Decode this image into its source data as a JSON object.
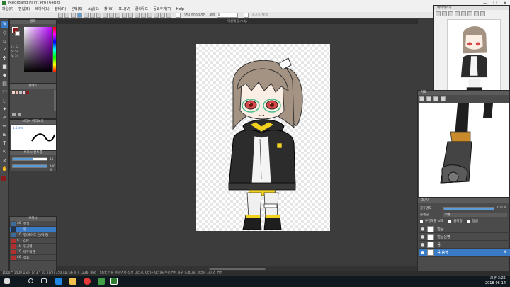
{
  "app": {
    "title": "MediBang Paint Pro (64bit)"
  },
  "window_controls": {
    "minimize": "—",
    "maximize": "☐",
    "close": "✕"
  },
  "menu": [
    "파일(F)",
    "편집(E)",
    "레이어(L)",
    "필터(R)",
    "선택(S)",
    "스냅(S)",
    "창(W)",
    "표시(V)",
    "클라우드",
    "동료추가(T)",
    "Help"
  ],
  "toolbar": {
    "aa_label": "안티 에일리어싱",
    "correction_label": "보정",
    "correction_value": "0",
    "fill_label": "소프트 채색"
  },
  "document": {
    "tab_title": "이름없음.mdp"
  },
  "color_panel": {
    "title": "컬러",
    "h": "H: 54",
    "s": "S: 54",
    "v": "V: 54"
  },
  "palette_panel": {
    "title": "팔레트"
  },
  "brush_preview_panel": {
    "title": "브러시 미리보기",
    "size": "1.5 mm"
  },
  "brush_control_panel": {
    "title": "브러시 컨트롤",
    "value1": "14",
    "value2": "100 %"
  },
  "brush_panel": {
    "title": "브러시",
    "items": [
      {
        "size": "20",
        "name": "연필"
      },
      {
        "size": "",
        "name": "펜"
      },
      {
        "size": "10",
        "name": "펜(페이드 인/아웃)"
      },
      {
        "size": "6",
        "name": "G펜"
      },
      {
        "size": "10",
        "name": "둥근펜"
      },
      {
        "size": "10",
        "name": "테두리펜"
      },
      {
        "size": "60",
        "name": "점묘"
      }
    ]
  },
  "navigator_panel": {
    "title": "내비게이터"
  },
  "material_panel": {
    "title": "자료"
  },
  "layer_panel": {
    "title": "레이어",
    "opacity_label": "불투명도",
    "opacity_value": "100 %",
    "blend_label": "블렌딩",
    "blend_value": "보통",
    "protect_label": "투명도를 보호",
    "clipping_label": "클리핑",
    "lock_label": "잠금",
    "layers": [
      {
        "name": "얼굴",
        "selected": false
      },
      {
        "name": "얼굴음영",
        "selected": false
      },
      {
        "name": "몸",
        "selected": false
      },
      {
        "name": "몸 음영",
        "selected": true
      }
    ]
  },
  "status": {
    "text": "1000 * 1400 pixel  (7.3 * 10.2cm)  350 dpi  56 %  ( 1236, 866 )  Shift 키를 누르면서 직선 그리기, Ctrl+Alt키를 누르면서 좌우 드래그로 브러시 사이즈 변경"
  },
  "taskbar": {
    "time": "오후 3:25",
    "date": "2018-06-14"
  },
  "colors": {
    "accent": "#3a7bc8",
    "panel": "#4b4b4b",
    "canvas_bg": "#3c3c3c"
  }
}
